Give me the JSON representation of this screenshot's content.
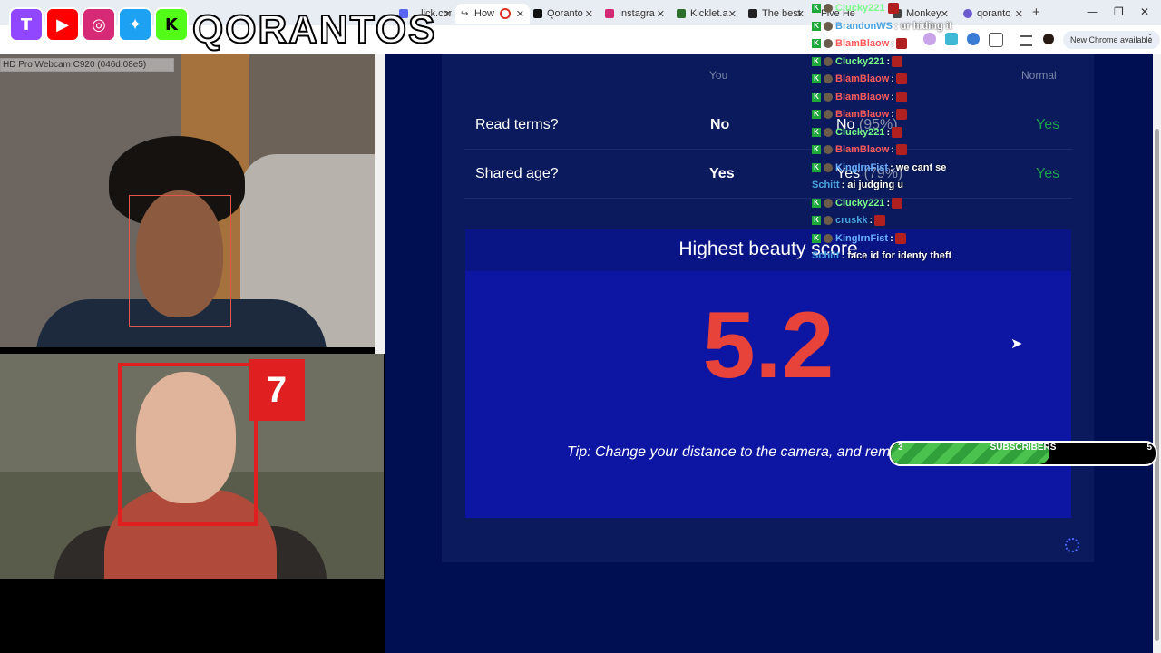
{
  "browser": {
    "tabs": [
      {
        "label": "...lick.com",
        "color": "#5865f2"
      },
      {
        "label": "How",
        "color": "#1a73e8",
        "active": true,
        "recording": true
      },
      {
        "label": "Qoranto",
        "color": "#111111"
      },
      {
        "label": "Instagra",
        "color": "#d62976"
      },
      {
        "label": "Kicklet.a",
        "color": "#2c6e2c"
      },
      {
        "label": "The best",
        "color": "#222222"
      },
      {
        "label": "Five He",
        "color": "#333333"
      },
      {
        "label": "Monkey",
        "color": "#444444"
      },
      {
        "label": "qoranto",
        "color": "#6a5acd"
      }
    ],
    "new_tab": "+",
    "window_controls": {
      "minimize": "—",
      "restore": "❐",
      "close": "✕"
    },
    "update_button": "New Chrome available",
    "menu": "⋮"
  },
  "webcam": {
    "device_label": "HD Pro Webcam C920 (046d:08e5)"
  },
  "photo": {
    "score": "7"
  },
  "overlay": {
    "brand": "QORANTOS",
    "socials": [
      {
        "icon": "twitch-icon",
        "glyph": "T",
        "color": "#9146ff"
      },
      {
        "icon": "youtube-icon",
        "glyph": "▶",
        "color": "#ff0000"
      },
      {
        "icon": "instagram-icon",
        "glyph": "◎",
        "color": "#d62976"
      },
      {
        "icon": "twitter-icon",
        "glyph": "🐦",
        "color": "#1da1f2"
      },
      {
        "icon": "kick-icon",
        "glyph": "K",
        "color": "#53fc18"
      }
    ]
  },
  "table": {
    "headers": {
      "you": "You",
      "normal": "Normal"
    },
    "rows": [
      {
        "label": "Read terms?",
        "you": "No",
        "other": "No",
        "other_pct": "(95%)",
        "normal": "Yes"
      },
      {
        "label": "Shared age?",
        "you": "Yes",
        "other": "Yes",
        "other_pct": "(79%)",
        "normal": "Yes"
      }
    ]
  },
  "beauty": {
    "title": "Highest beauty score",
    "score": "5.2",
    "tip": "Tip: Change your distance to the camera, and rem"
  },
  "chat": [
    {
      "user": "Clucky221",
      "text": "",
      "color": "#7cfc8a",
      "badge": "kick",
      "emote": true
    },
    {
      "user": "BrandonWS",
      "text": ": ur hiding it",
      "color": "#4aa3e0",
      "badge": "kick"
    },
    {
      "user": "BlamBlaow",
      "text": ":",
      "color": "#ff5a5a",
      "badge": "kick",
      "emote": true
    },
    {
      "user": "Clucky221",
      "text": ":",
      "color": "#7cfc8a",
      "badge": "kick",
      "emote": true
    },
    {
      "user": "BlamBlaow",
      "text": ":",
      "color": "#ff5a5a",
      "badge": "kick",
      "emote": true
    },
    {
      "user": "BlamBlaow",
      "text": ":",
      "color": "#ff5a5a",
      "badge": "kick",
      "emote": true
    },
    {
      "user": "BlamBlaow",
      "text": ":",
      "color": "#ff5a5a",
      "badge": "kick",
      "emote": true
    },
    {
      "user": "Clucky221",
      "text": ":",
      "color": "#7cfc8a",
      "badge": "kick",
      "emote": true
    },
    {
      "user": "BlamBlaow",
      "text": ":",
      "color": "#ff5a5a",
      "badge": "kick",
      "emote": true
    },
    {
      "user": "KingIrnFist",
      "text": ": we cant se",
      "color": "#6ab0ff",
      "badge": "kick"
    },
    {
      "user": "Schitt",
      "text": ": ai judging u",
      "color": "#4aa3e0",
      "badge": "none"
    },
    {
      "user": "Clucky221",
      "text": ":",
      "color": "#7cfc8a",
      "badge": "kick",
      "emote": true
    },
    {
      "user": "cruskk",
      "text": ":",
      "color": "#4aa3e0",
      "badge": "kick",
      "emote": true
    },
    {
      "user": "KingIrnFist",
      "text": ":",
      "color": "#6ab0ff",
      "badge": "kick",
      "emote": true
    },
    {
      "user": "Schitt",
      "text": ": face id for identy theft",
      "color": "#4aa3e0",
      "badge": "none"
    }
  ],
  "subscribers": {
    "label": "SUBSCRIBERS",
    "current": "3",
    "goal": "5",
    "progress": 0.6
  }
}
